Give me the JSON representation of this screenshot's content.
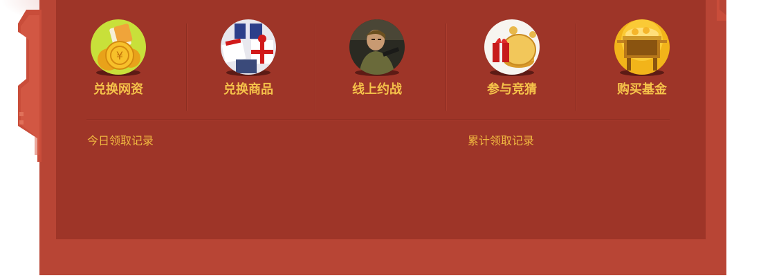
{
  "menu": {
    "items": [
      {
        "label": "兑换网资",
        "icon": "gold-coins-icon"
      },
      {
        "label": "兑换商品",
        "icon": "gift-boxes-icon"
      },
      {
        "label": "线上约战",
        "icon": "game-character-icon"
      },
      {
        "label": "参与竞猜",
        "icon": "coin-gift-icon"
      },
      {
        "label": "购买基金",
        "icon": "treasure-cauldron-icon"
      }
    ]
  },
  "records": {
    "today_label": "今日领取记录",
    "total_label": "累计领取记录"
  },
  "colors": {
    "outer_panel": "#b84535",
    "inner_panel": "#9e3528",
    "label_gold": "#f5c24a",
    "record_text": "#f0b840"
  }
}
